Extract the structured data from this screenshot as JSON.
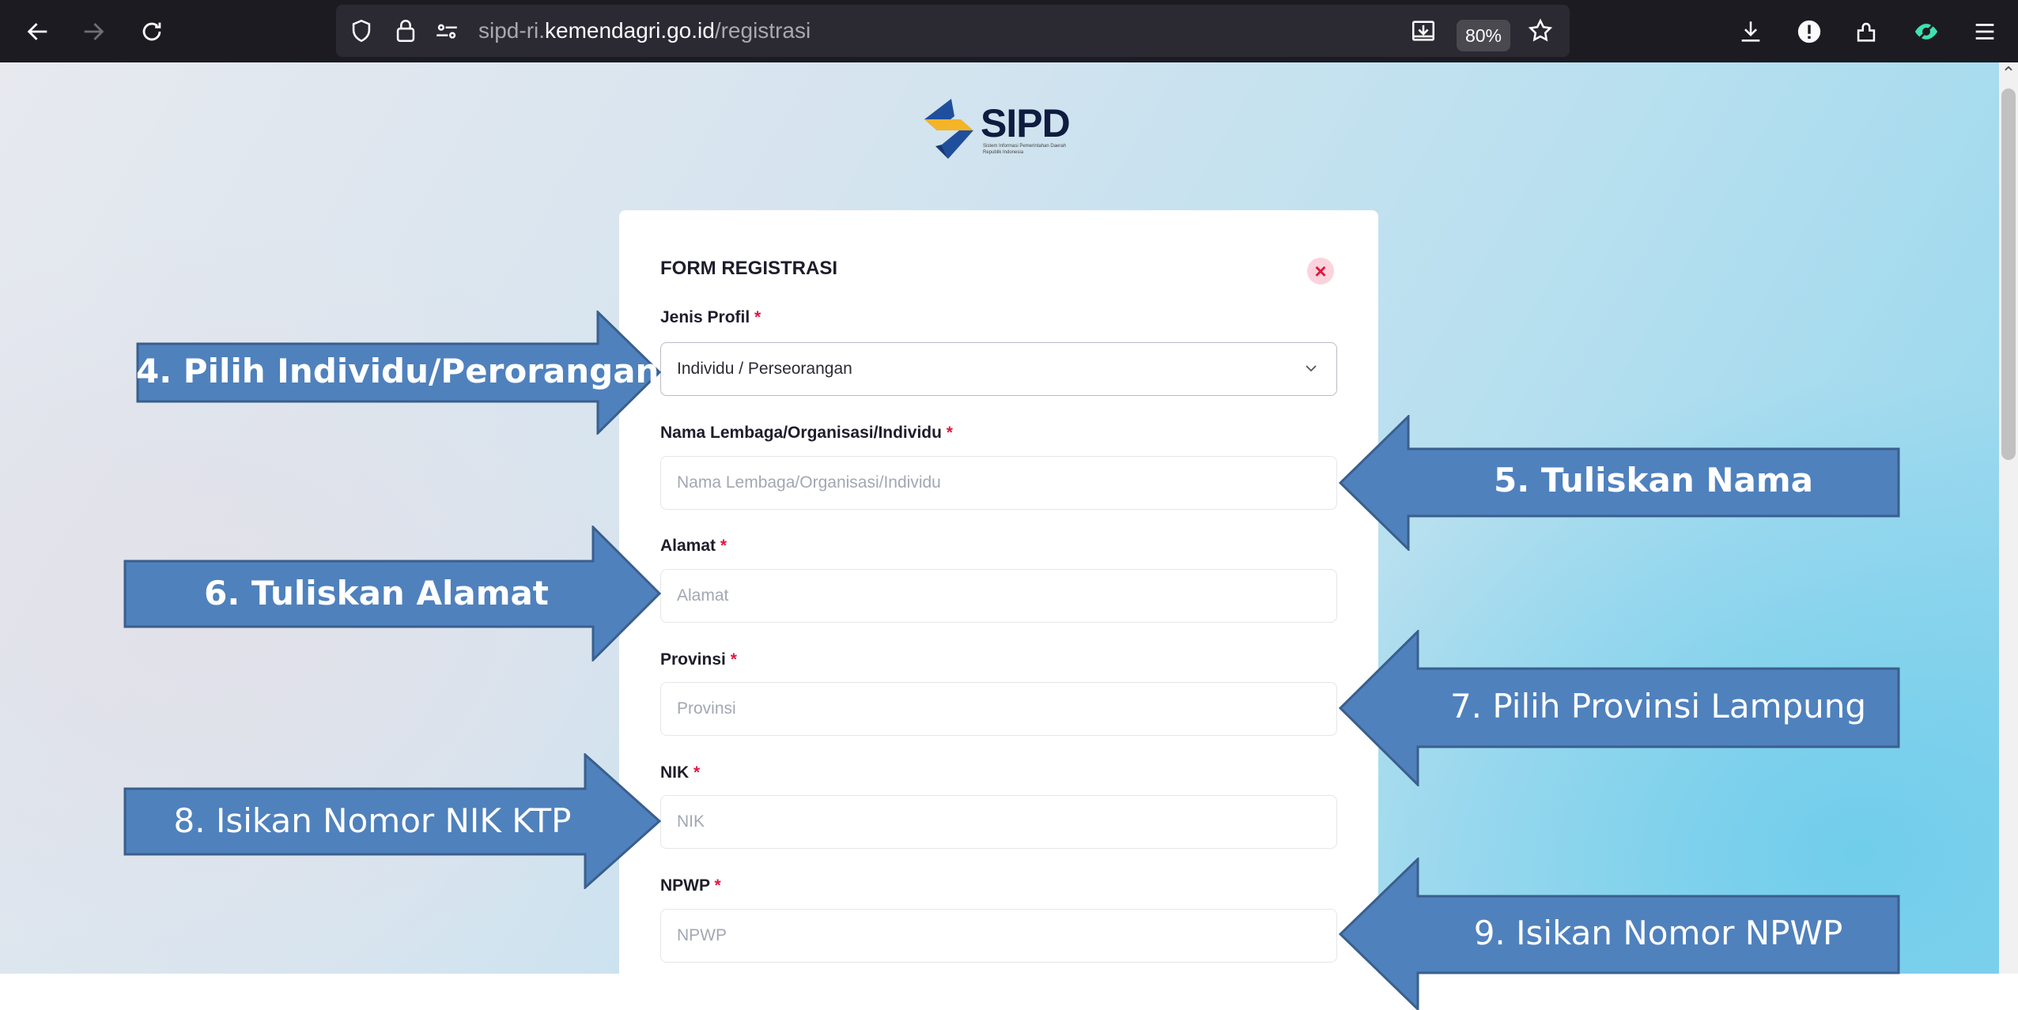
{
  "browser": {
    "url_prefix": "sipd-ri.",
    "url_host": "kemendagri.go.id",
    "url_path": "/registrasi",
    "zoom": "80%",
    "icons": [
      "back-icon",
      "forward-icon",
      "reload-icon",
      "shield-icon",
      "lock-icon",
      "permissions-icon",
      "save-to-pocket-icon",
      "bookmark-star-icon",
      "downloads-icon",
      "password-manager-icon",
      "extensions-icon",
      "tracking-protection-icon",
      "menu-icon"
    ]
  },
  "logo": {
    "text": "SIPD",
    "tagline": "Sistem Informasi Pemerintahan Daerah Republik Indonesia"
  },
  "form": {
    "title": "FORM REGISTRASI",
    "required_mark": "*",
    "jenis_profil": {
      "label": "Jenis Profil",
      "value": "Individu / Perseorangan"
    },
    "nama": {
      "label": "Nama Lembaga/Organisasi/Individu",
      "placeholder": "Nama Lembaga/Organisasi/Individu"
    },
    "alamat": {
      "label": "Alamat",
      "placeholder": "Alamat"
    },
    "provinsi": {
      "label": "Provinsi",
      "placeholder": "Provinsi"
    },
    "nik": {
      "label": "NIK",
      "placeholder": "NIK"
    },
    "npwp": {
      "label": "NPWP",
      "placeholder": "NPWP"
    }
  },
  "annotations": {
    "step4": "4. Pilih Individu/Perorangan",
    "step5": "5. Tuliskan Nama",
    "step6": "6. Tuliskan Alamat",
    "step7": "7.  Pilih Provinsi Lampung",
    "step8": "8. Isikan Nomor NIK KTP",
    "step9": "9. Isikan Nomor NPWP",
    "arrow_color": "#4f81bd",
    "arrow_border": "#3a5f8d"
  }
}
